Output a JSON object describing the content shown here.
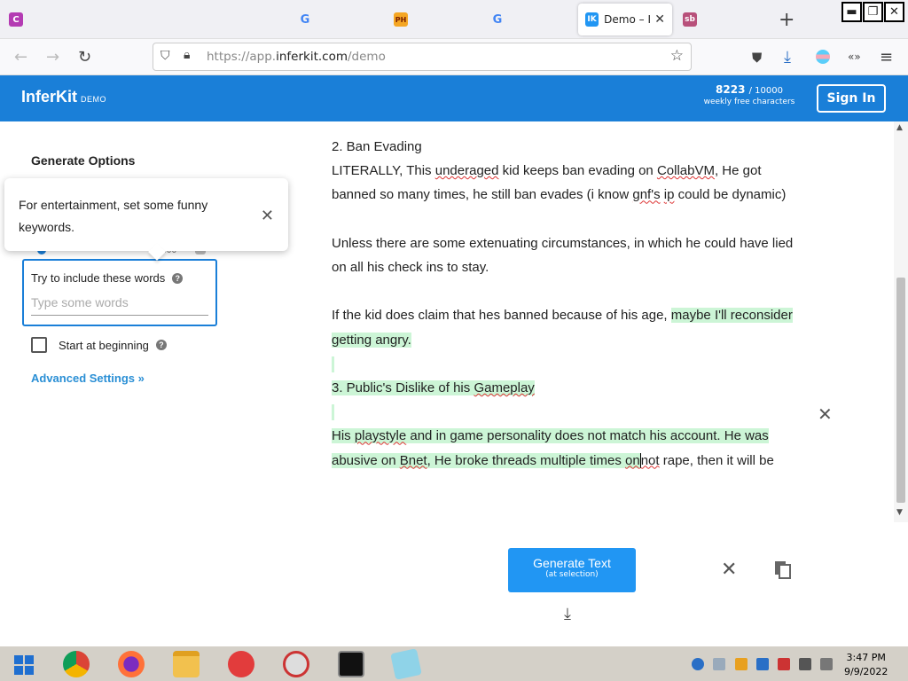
{
  "browser": {
    "active_tab_title": "Demo – InferKit",
    "tab_favicons": [
      {
        "label": "C",
        "color": "#b43bb3"
      },
      {
        "label": "G",
        "color": "#ffffff"
      },
      {
        "label": "PH",
        "color": "#f5a623"
      },
      {
        "label": "G",
        "color": "#ffffff"
      },
      {
        "label": "IK",
        "color": "#2196f3"
      },
      {
        "label": "sb",
        "color": "#b8507a"
      }
    ],
    "url_prefix": "https://app.",
    "url_domain": "inferkit.com",
    "url_path": "/demo"
  },
  "header": {
    "logo": "InferKit",
    "logo_sub": "DEMO",
    "chars_count": "8223",
    "chars_limit": "/ 10000",
    "chars_label": "weekly free characters",
    "sign_in": "Sign In"
  },
  "sidebar": {
    "title": "Generate Options",
    "tooltip": "For entertainment, set some funny keywords.",
    "keywords_label": "Try to include these words",
    "keywords_placeholder": "Type some words",
    "start_label": "Start at beginning",
    "advanced": "Advanced Settings »"
  },
  "editor": {
    "l1": "2. Ban Evading",
    "l2a": "LITERALLY, This ",
    "l2b": "underaged",
    "l2c": " kid keeps ban evading on ",
    "l2d": "CollabVM",
    "l2e": ", He got banned so many times, he still ban evades (i know ",
    "l2f": "gnf's",
    "l2g": " ",
    "l2h": "ip",
    "l2i": " could be dynamic)",
    "l3": "Unless there are some extenuating circumstances, in which he could have lied on all his check ins to stay.",
    "l4a": "If the kid does claim that hes banned because of his age, ",
    "l4b": "maybe I'll reconsider getting angry.",
    "l5a": "3. Public's Dislike of his ",
    "l5b": "Gameplay",
    "l6a": "His ",
    "l6b": "playstyle",
    "l6c": " and in game personality does not match his account. He was abusive on ",
    "l6d": "Bnet",
    "l6e": ", He broke threads multiple times ",
    "l6f": "on",
    "l7a": "not",
    "l7b": " rape, then it will be"
  },
  "actions": {
    "generate": "Generate Text",
    "generate_sub": "(at selection)"
  },
  "taskbar": {
    "time": "3:47 PM",
    "date": "9/9/2022"
  }
}
